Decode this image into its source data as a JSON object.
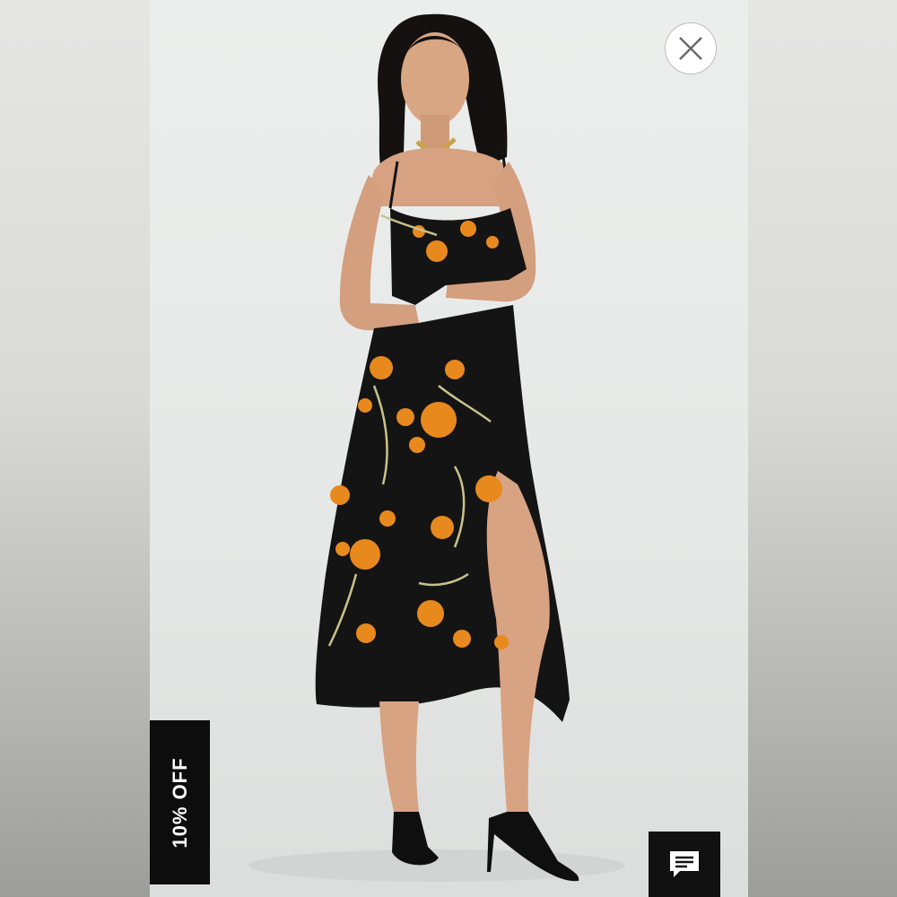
{
  "page": {
    "background": "#d6d6d4"
  },
  "product_image": {
    "subject": "model-in-floral-midi-dress",
    "dress_color": "#141414",
    "flower_color": "#e8891e",
    "leaf_color": "#c9c38a"
  },
  "close_button": {
    "icon": "close-icon"
  },
  "discount_badge": {
    "label": "10% OFF"
  },
  "chat_button": {
    "icon": "chat-bubble-icon"
  }
}
